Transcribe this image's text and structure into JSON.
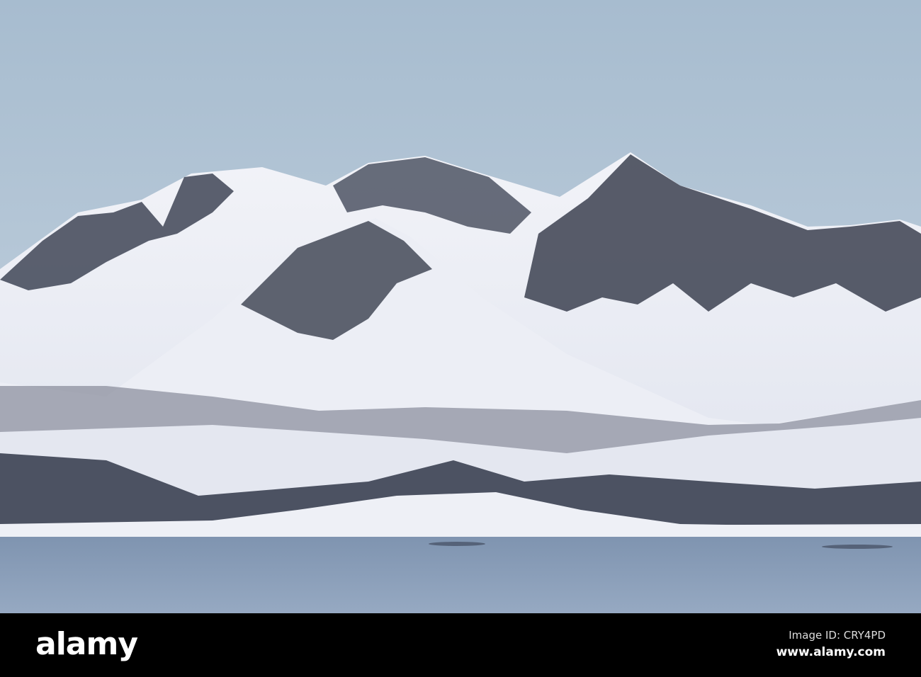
{
  "watermark": {
    "logo": "alamy",
    "image_id_label": "Image ID: CRY4PD",
    "url": "www.alamy.com"
  },
  "colors": {
    "sky_top": "#a7bccf",
    "sky_bottom": "#c9d6e2",
    "snow": "#eef0f6",
    "rock": "#3c4150",
    "water": "#8da1bb",
    "bar": "#000000"
  }
}
